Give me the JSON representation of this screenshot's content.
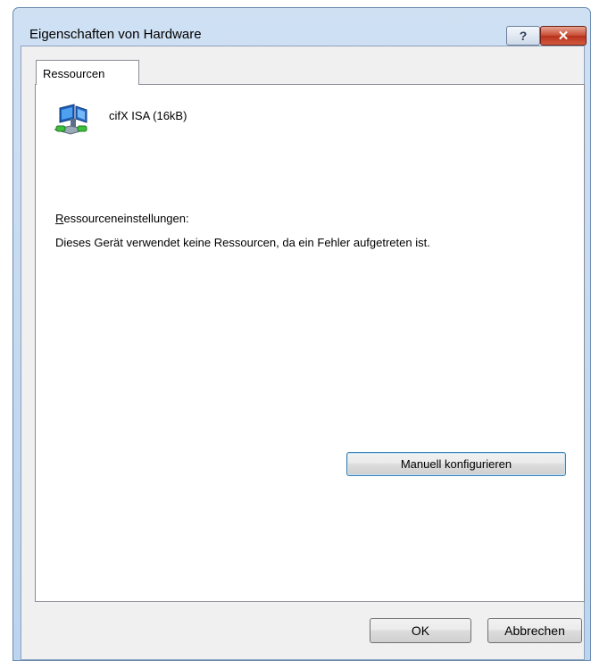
{
  "window": {
    "title": "Eigenschaften von Hardware",
    "help_glyph": "?",
    "close_glyph": "✕"
  },
  "tabs": [
    {
      "label": "Ressourcen",
      "selected": true
    }
  ],
  "device": {
    "name": "cifX ISA (16kB)",
    "icon": "network-adapter-icon"
  },
  "resources": {
    "label_accel": "R",
    "label_rest": "essourceneinstellungen:",
    "message": "Dieses Gerät verwendet keine Ressourcen, da ein Fehler aufgetreten ist."
  },
  "buttons": {
    "manual_config": "Manuell konfigurieren",
    "ok": "OK",
    "cancel": "Abbrechen"
  }
}
